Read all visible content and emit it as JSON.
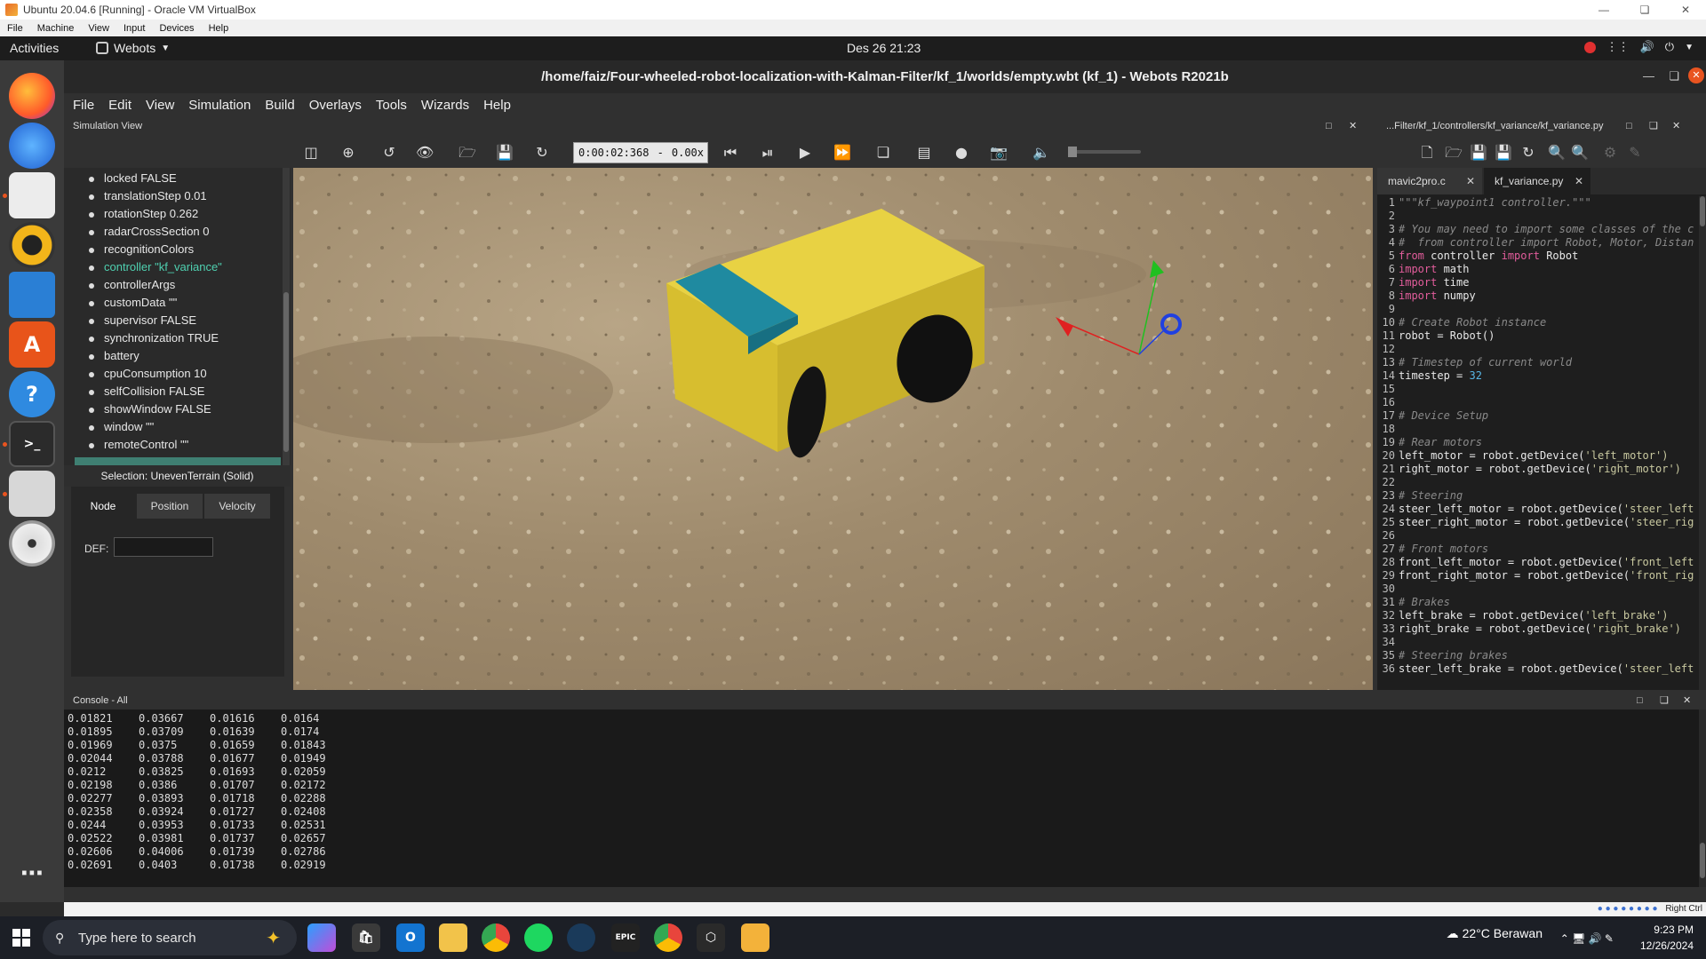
{
  "vbox": {
    "title": "Ubuntu 20.04.6 [Running] - Oracle VM VirtualBox",
    "menu": [
      "File",
      "Machine",
      "View",
      "Input",
      "Devices",
      "Help"
    ],
    "status_right": "Right Ctrl"
  },
  "ubuntu_bar": {
    "activities": "Activities",
    "app_menu": "Webots",
    "clock": "Des 26  21:23"
  },
  "webots": {
    "title": "/home/faiz/Four-wheeled-robot-localization-with-Kalman-Filter/kf_1/worlds/empty.wbt (kf_1) - Webots R2021b",
    "menu": [
      "File",
      "Edit",
      "View",
      "Simulation",
      "Build",
      "Overlays",
      "Tools",
      "Wizards",
      "Help"
    ],
    "simulation_view_label": "Simulation View",
    "time": "0:00:02:368",
    "time_sep": "-",
    "speed": "0.00x",
    "scene_tree": [
      "locked FALSE",
      "translationStep 0.01",
      "rotationStep 0.262",
      "radarCrossSection 0",
      "recognitionColors",
      "controller \"kf_variance\"",
      "controllerArgs",
      "customData \"\"",
      "supervisor FALSE",
      "synchronization TRUE",
      "battery",
      "cpuConsumption 10",
      "selfCollision FALSE",
      "showWindow FALSE",
      "window \"\"",
      "remoteControl \"\""
    ],
    "selection_label": "Selection: UnevenTerrain (Solid)",
    "field_tabs": [
      "Node",
      "Position",
      "Velocity"
    ],
    "def_label": "DEF:",
    "editor_path": "...Filter/kf_1/controllers/kf_variance/kf_variance.py",
    "editor_tabs": [
      "mavic2pro.c",
      "kf_variance.py"
    ],
    "code_lines": [
      "\"\"\"kf_waypoint1 controller.\"\"\"",
      "",
      "# You may need to import some classes of the c",
      "#  from controller import Robot, Motor, Distan",
      "from controller import Robot",
      "import math",
      "import time",
      "import numpy",
      "",
      "# Create Robot instance",
      "robot = Robot()",
      "",
      "# Timestep of current world",
      "timestep = 32",
      "",
      "",
      "# Device Setup",
      "",
      "# Rear motors",
      "left_motor = robot.getDevice('left_motor')",
      "right_motor = robot.getDevice('right_motor')",
      "",
      "# Steering",
      "steer_left_motor = robot.getDevice('steer_left",
      "steer_right_motor = robot.getDevice('steer_rig",
      "",
      "# Front motors",
      "front_left_motor = robot.getDevice('front_left",
      "front_right_motor = robot.getDevice('front_rig",
      "",
      "# Brakes",
      "left_brake = robot.getDevice('left_brake')",
      "right_brake = robot.getDevice('right_brake')",
      "",
      "# Steering brakes",
      "steer_left_brake = robot.getDevice('steer_left"
    ],
    "console_label": "Console - All",
    "console_rows": [
      [
        "0.01821",
        "0.03667",
        "0.01616",
        "0.0164"
      ],
      [
        "0.01895",
        "0.03709",
        "0.01639",
        "0.0174"
      ],
      [
        "0.01969",
        "0.0375",
        "0.01659",
        "0.01843"
      ],
      [
        "0.02044",
        "0.03788",
        "0.01677",
        "0.01949"
      ],
      [
        "0.0212",
        "0.03825",
        "0.01693",
        "0.02059"
      ],
      [
        "0.02198",
        "0.0386",
        "0.01707",
        "0.02172"
      ],
      [
        "0.02277",
        "0.03893",
        "0.01718",
        "0.02288"
      ],
      [
        "0.02358",
        "0.03924",
        "0.01727",
        "0.02408"
      ],
      [
        "0.0244",
        "0.03953",
        "0.01733",
        "0.02531"
      ],
      [
        "0.02522",
        "0.03981",
        "0.01737",
        "0.02657"
      ],
      [
        "0.02606",
        "0.04006",
        "0.01739",
        "0.02786"
      ],
      [
        "0.02691",
        "0.0403",
        "0.01738",
        "0.02919"
      ]
    ]
  },
  "taskbar": {
    "search_placeholder": "Type here to search",
    "weather": "22°C  Berawan",
    "time": "9:23 PM",
    "date": "12/26/2024"
  },
  "colors": {
    "highlight_tree": "#4fd0b0",
    "robot_body": "#e0c93a",
    "robot_panel": "#1f8aa0",
    "record": "#e03030"
  }
}
